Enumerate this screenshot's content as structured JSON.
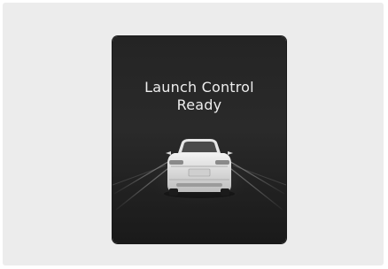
{
  "cluster": {
    "message_line1": "Launch Control",
    "message_line2": "Ready",
    "icon": "car-rear-view-icon"
  }
}
